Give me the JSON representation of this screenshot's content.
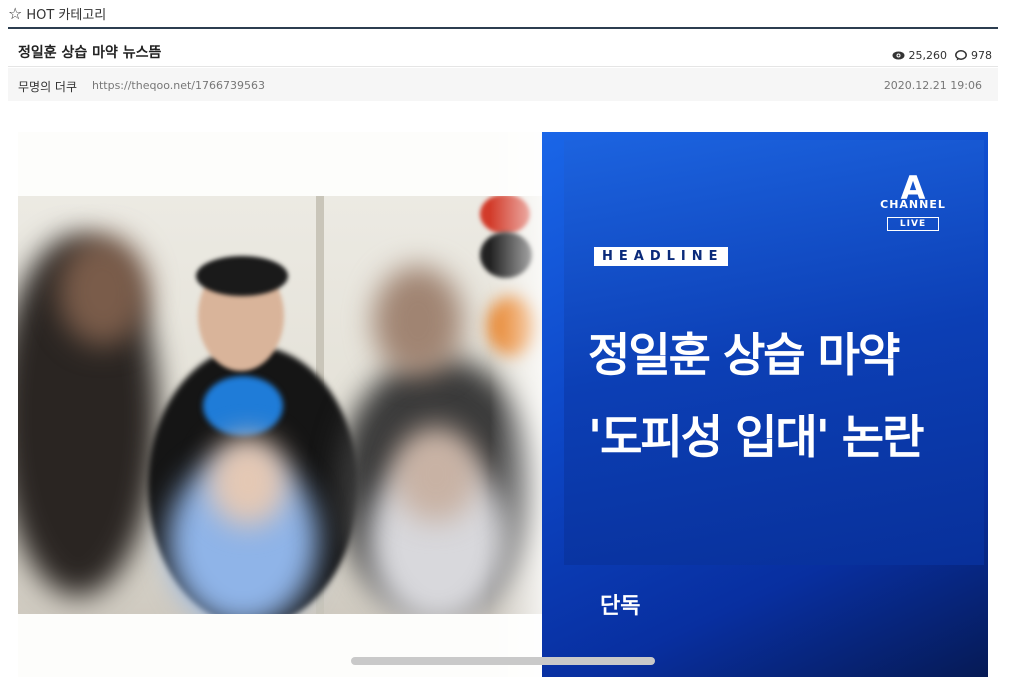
{
  "topbar": {
    "star_icon": "☆",
    "category": "HOT 카테고리"
  },
  "post": {
    "title": "정일훈 상습 마약 뉴스뜸",
    "views": "25,260",
    "comments": "978",
    "author": "무명의 더쿠",
    "url": "https://theqoo.net/1766739563",
    "date": "2020.12.21 19:06"
  },
  "media": {
    "logo_letter": "A",
    "logo_channel": "CHANNEL",
    "logo_live": "LIVE",
    "tag": "HEADLINE",
    "headline_line1": "정일훈 상습 마약",
    "headline_line2": "'도피성 입대' 논란",
    "exclusive": "단독"
  },
  "colors": {
    "accent_line": "#2c3e50",
    "panel_blue": "#0d47c7"
  }
}
